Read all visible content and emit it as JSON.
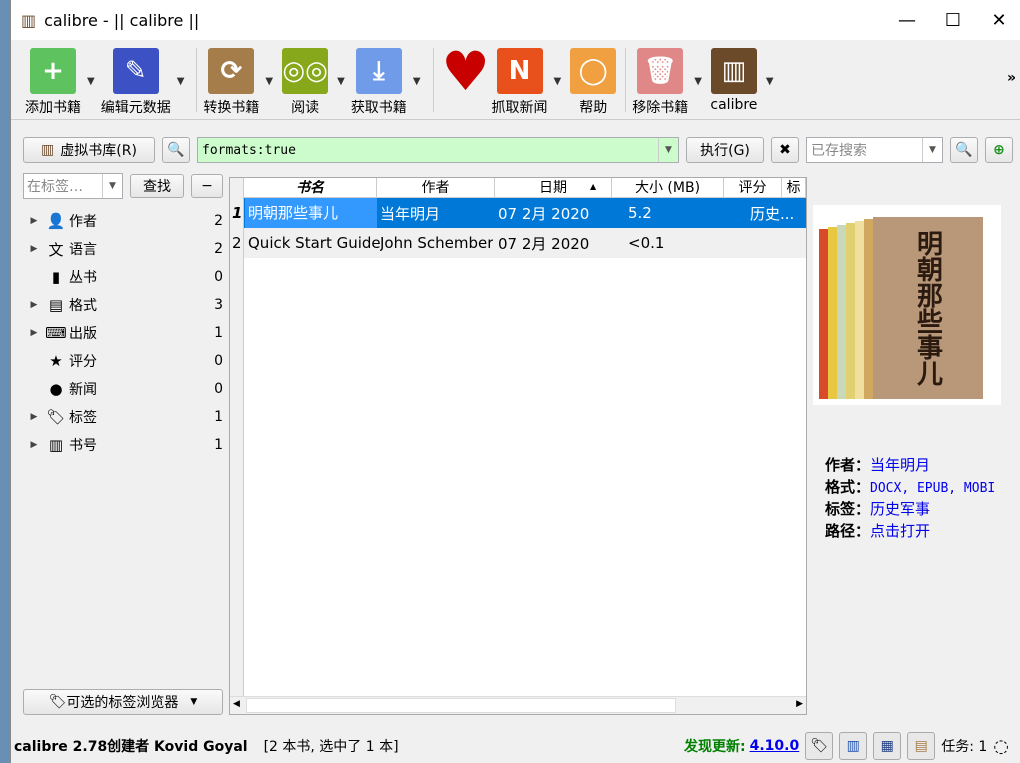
{
  "window": {
    "title": "calibre - || calibre ||",
    "minimize": "—",
    "maximize": "☐",
    "close": "✕"
  },
  "toolbar": {
    "items": [
      {
        "label": "添加书籍",
        "icon": "add-book-icon",
        "color": "#5ec25e",
        "glyph": "+"
      },
      {
        "label": "编辑元数据",
        "icon": "edit-metadata-icon",
        "color": "#3c52c4",
        "glyph": "✎"
      },
      {
        "label": "转换书籍",
        "icon": "convert-book-icon",
        "color": "#a57d4b",
        "glyph": "⟳"
      },
      {
        "label": "阅读",
        "icon": "read-book-icon",
        "color": "#86a81a",
        "glyph": "◎◎"
      },
      {
        "label": "获取书籍",
        "icon": "get-books-icon",
        "color": "#6f9be8",
        "glyph": "⤓"
      },
      {
        "label": "",
        "icon": "heart-icon",
        "color": "#c80000",
        "glyph": "♥"
      },
      {
        "label": "抓取新闻",
        "icon": "fetch-news-icon",
        "color": "#e8501c",
        "glyph": "N"
      },
      {
        "label": "帮助",
        "icon": "help-lifebuoy-icon",
        "color": "#f0a040",
        "glyph": "◯"
      },
      {
        "label": "移除书籍",
        "icon": "remove-book-icon",
        "color": "#e08888",
        "glyph": "🗑"
      },
      {
        "label": "calibre",
        "icon": "calibre-library-icon",
        "color": "#6b4a2a",
        "glyph": "▥"
      }
    ],
    "more": "»"
  },
  "search": {
    "virtual_library": "虚拟书库(R)",
    "query": "formats:true",
    "execute": "执行(G)",
    "saved_placeholder": "已存搜索"
  },
  "tag_browser": {
    "filter_placeholder": "在标签…",
    "find": "查找",
    "collapse": "−",
    "items": [
      {
        "label": "作者",
        "count": "2",
        "icon": "author-icon",
        "glyph": "👤",
        "expandable": true
      },
      {
        "label": "语言",
        "count": "2",
        "icon": "language-icon",
        "glyph": "文",
        "expandable": true
      },
      {
        "label": "丛书",
        "count": "0",
        "icon": "series-icon",
        "glyph": "▮",
        "expandable": false
      },
      {
        "label": "格式",
        "count": "3",
        "icon": "format-icon",
        "glyph": "▤",
        "expandable": true
      },
      {
        "label": "出版",
        "count": "1",
        "icon": "publisher-icon",
        "glyph": "⌨",
        "expandable": true
      },
      {
        "label": "评分",
        "count": "0",
        "icon": "rating-star-icon",
        "glyph": "★",
        "expandable": false
      },
      {
        "label": "新闻",
        "count": "0",
        "icon": "news-icon",
        "glyph": "●",
        "expandable": false
      },
      {
        "label": "标签",
        "count": "1",
        "icon": "tag-icon",
        "glyph": "🏷",
        "expandable": true
      },
      {
        "label": "书号",
        "count": "1",
        "icon": "isbn-barcode-icon",
        "glyph": "▥",
        "expandable": true
      }
    ],
    "alt_browser": "可选的标签浏览器"
  },
  "table": {
    "columns": [
      "书名",
      "作者",
      "日期",
      "大小 (MB)",
      "评分",
      "标签"
    ],
    "rows": [
      {
        "num": "1",
        "title": "明朝那些事儿",
        "author": "当年明月",
        "date": "07 2月 2020",
        "size": "5.2",
        "rating": "",
        "tags": "历史..."
      },
      {
        "num": "2",
        "title": "Quick Start Guide",
        "author": "John Schember",
        "date": "07 2月 2020",
        "size": "<0.1",
        "rating": "",
        "tags": ""
      }
    ]
  },
  "details": {
    "cover_title": "明朝那些事儿",
    "fields": [
      {
        "label": "作者：",
        "value": "当年明月",
        "mono": false
      },
      {
        "label": "格式：",
        "value": "DOCX, EPUB, MOBI",
        "mono": true
      },
      {
        "label": "标签：",
        "value": "历史军事",
        "mono": false
      },
      {
        "label": "路径：",
        "value": "点击打开",
        "mono": false
      }
    ]
  },
  "status": {
    "left": "calibre 2.78创建者 Kovid Goyal",
    "count": "[2 本书, 选中了 1 本]",
    "update_label": "发现更新:",
    "update_version": "4.10.0",
    "jobs": "任务: 1"
  },
  "colors": {
    "accent": "#0078d7",
    "search_bg": "#ccfccc",
    "update_green": "#008000"
  }
}
